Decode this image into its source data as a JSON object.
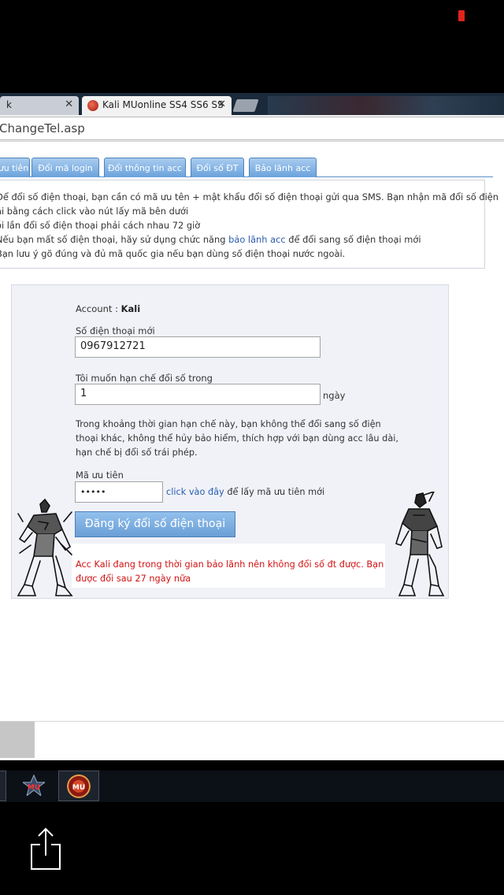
{
  "browser": {
    "tabs": [
      {
        "label": "k",
        "active": false
      },
      {
        "label": "Kali MUonline SS4 SS6 SS",
        "active": true
      }
    ],
    "url": "ChangeTel.asp"
  },
  "nav": {
    "tabs": [
      {
        "label": "ưu tiên"
      },
      {
        "label": "Đổi mã login"
      },
      {
        "label": "Đổi thông tin acc"
      },
      {
        "label": "Đổi số ĐT"
      },
      {
        "label": "Bảo lãnh acc"
      }
    ]
  },
  "info": {
    "line1": "Để đổi số điện thoại, bạn cần có mã ưu tên + mật khẩu đổi số điện thoại gửi qua SMS. Bạn nhận mã đổi số điện",
    "line2": "ại bằng cách click vào nút lấy mã bên dưới",
    "line3": "ỗi lần đổi số điện thoại phải cách nhau 72 giờ",
    "line4_pre": "Nếu bạn mất số điện thoại, hãy sử dụng chức năng ",
    "line4_link": "bảo lãnh acc",
    "line4_post": " để đổi sang số điện thoại mới",
    "line5": "Bạn lưu ý gõ đúng và đủ mã quốc gia nếu bạn dùng số điện thoại nước ngoài."
  },
  "form": {
    "account_label": "Account : ",
    "account_value": "Kali",
    "phone_label": "Số điện thoại mới",
    "phone_value": "0967912721",
    "limit_label": "Tôi muốn hạn chế đổi số trong",
    "limit_value": "1",
    "limit_unit": "ngày",
    "desc1": "Trong khoảng thời gian hạn chế này, bạn không thể đổi sang số điện",
    "desc2": "thoại khác, không thể hủy bảo hiểm, thích hợp với bạn dùng acc lâu dài,",
    "desc3": "hạn chế bị đổi số trái phép.",
    "code_label": "Mã ưu tiên",
    "code_value": "•••••",
    "code_link": "click vào đây",
    "code_link_suffix": " để lấy mã ưu tiên mới",
    "submit_label": "Đăng ký đổi số điện thoại",
    "error1": "Acc Kali đang trong thời gian bảo lãnh nên không đổi số đt được. Bạn",
    "error2": "được đổi sau 27 ngày nữa"
  },
  "colors": {
    "tab_blue": "#6aa2dc",
    "error_red": "#d31212",
    "link_blue": "#2a5db0",
    "recording": "#e0241c"
  },
  "icons": {
    "taskbar": [
      "mu-game-icon",
      "mu-logo-icon"
    ],
    "share": "share-icon"
  }
}
